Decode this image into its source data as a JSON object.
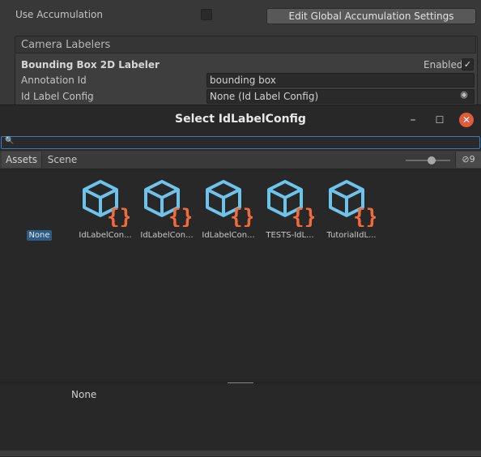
{
  "inspector": {
    "use_accumulation_label": "Use Accumulation",
    "use_accumulation_checked": false,
    "edit_global_button": "Edit Global Accumulation Settings",
    "camera_labelers_header": "Camera Labelers",
    "labeler_title": "Bounding Box 2D Labeler",
    "enabled_label": "Enabled",
    "enabled_checked": true,
    "annotation_id_label": "Annotation Id",
    "annotation_id_value": "bounding box",
    "id_label_config_label": "Id Label Config",
    "id_label_config_value": "None (Id Label Config)"
  },
  "dialog": {
    "title": "Select IdLabelConfig",
    "search_value": "",
    "tabs": [
      "Assets",
      "Scene"
    ],
    "active_tab": "Assets",
    "hidden_count": "9",
    "items": [
      {
        "label": "None",
        "selected": true
      },
      {
        "label": "IdLabelCon...",
        "icon": "config-asset-icon"
      },
      {
        "label": "IdLabelCon...",
        "icon": "config-asset-icon"
      },
      {
        "label": "IdLabelCon...",
        "icon": "config-asset-icon"
      },
      {
        "label": "TESTS-IdL...",
        "icon": "config-asset-icon"
      },
      {
        "label": "TutorialIdL...",
        "icon": "config-asset-icon"
      }
    ],
    "preview_text": "None"
  },
  "colors": {
    "icon_cube": "#6ec3ea",
    "icon_braces": "#f26b3c",
    "selection": "#2c5d87",
    "close_button": "#e25a3c",
    "search_focus": "#3a7cc4"
  }
}
